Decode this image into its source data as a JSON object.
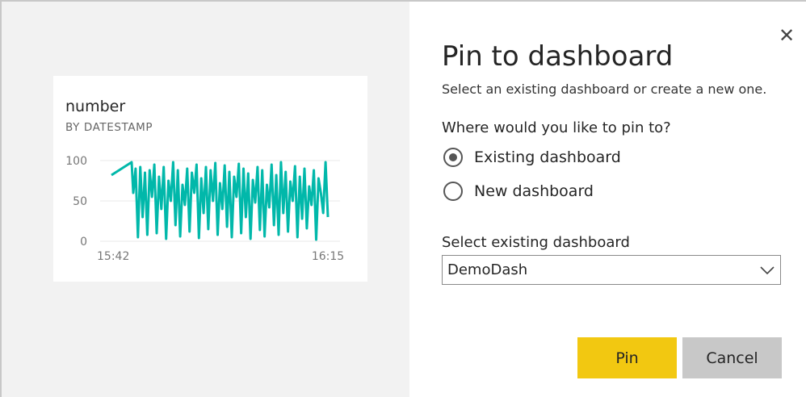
{
  "tile": {
    "title": "number",
    "subtitle": "BY DATESTAMP",
    "series_color": "#01b8aa"
  },
  "chart_data": {
    "type": "line",
    "title": "number",
    "subtitle": "BY DATESTAMP",
    "x_ticks": [
      "15:42",
      "16:15"
    ],
    "y_ticks": [
      0,
      50,
      100
    ],
    "ylim": [
      0,
      100
    ],
    "grid": true,
    "series": [
      {
        "values": [
          82,
          98,
          60,
          90,
          5,
          92,
          30,
          85,
          8,
          88,
          55,
          95,
          10,
          80,
          40,
          92,
          3,
          75,
          50,
          98,
          20,
          88,
          6,
          70,
          45,
          90,
          12,
          85,
          60,
          95,
          4,
          78,
          35,
          92,
          15,
          88,
          50,
          97,
          8,
          72,
          40,
          94,
          18,
          86,
          5,
          80,
          55,
          96,
          10,
          90,
          30,
          84,
          3,
          76,
          48,
          92,
          14,
          88,
          6,
          70,
          42,
          95,
          20,
          82,
          8,
          98,
          35,
          86,
          12,
          74,
          50,
          93,
          5,
          80,
          28,
          90,
          16,
          68,
          45,
          88,
          2,
          78,
          60,
          35,
          98,
          30
        ]
      }
    ]
  },
  "dialog": {
    "close_glyph": "✕",
    "title": "Pin to dashboard",
    "description": "Select an existing dashboard or create a new one.",
    "question": "Where would you like to pin to?",
    "options": [
      {
        "label": "Existing dashboard",
        "checked": true
      },
      {
        "label": "New dashboard",
        "checked": false
      }
    ],
    "select_label": "Select existing dashboard",
    "select_value": "DemoDash",
    "pin_label": "Pin",
    "cancel_label": "Cancel"
  }
}
